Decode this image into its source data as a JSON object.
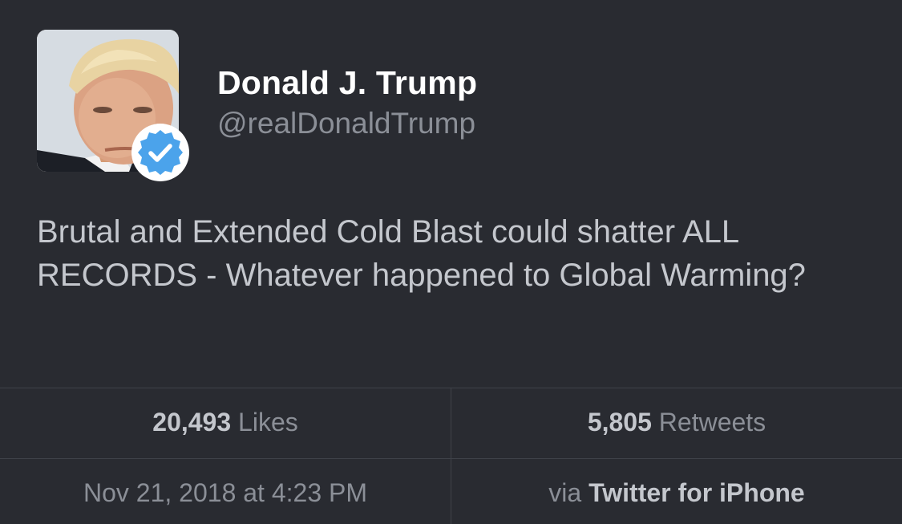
{
  "author": {
    "name": "Donald J. Trump",
    "handle": "@realDonaldTrump",
    "verified": true
  },
  "tweet": {
    "text": "Brutal and Extended Cold Blast could shatter ALL RECORDS - Whatever happened to Global Warming?"
  },
  "stats": {
    "likes_count": "20,493",
    "likes_label": " Likes",
    "retweets_count": "5,805",
    "retweets_label": " Retweets"
  },
  "meta": {
    "timestamp": "Nov 21, 2018 at 4:23 PM",
    "via_prefix": "via ",
    "source": "Twitter for iPhone"
  },
  "colors": {
    "background": "#292b31",
    "verified_badge": "#4ba3eb",
    "name": "#ffffff",
    "secondary_text": "#8b8f97",
    "body_text": "#c4c7cd"
  },
  "icons": {
    "avatar": "profile-photo",
    "verified": "verified-check-icon"
  }
}
